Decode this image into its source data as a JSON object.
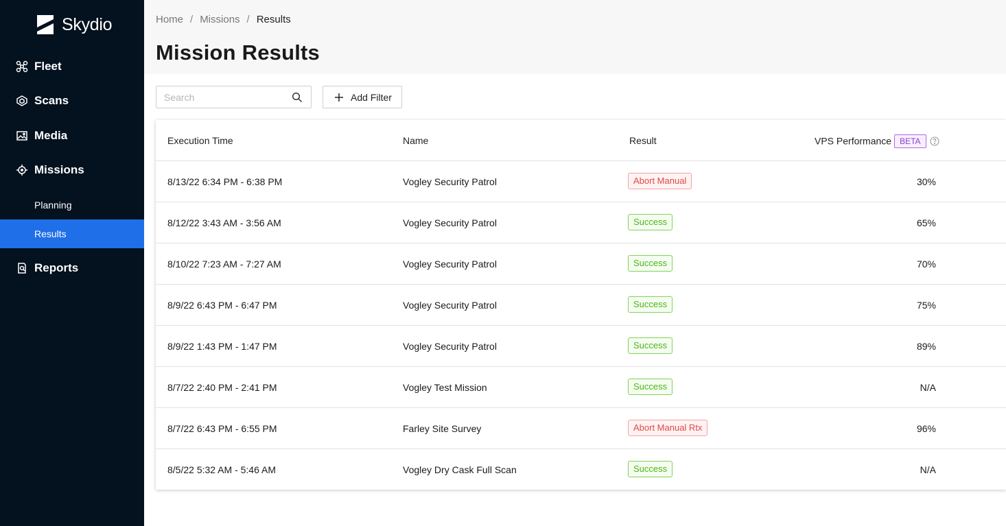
{
  "brand": {
    "name": "Skydio"
  },
  "sidebar": {
    "items": [
      {
        "label": "Fleet",
        "icon": "drone-icon"
      },
      {
        "label": "Scans",
        "icon": "scan-icon"
      },
      {
        "label": "Media",
        "icon": "image-icon"
      },
      {
        "label": "Missions",
        "icon": "target-icon"
      },
      {
        "label": "Reports",
        "icon": "report-icon"
      }
    ],
    "sub_items": [
      {
        "label": "Planning",
        "active": false
      },
      {
        "label": "Results",
        "active": true
      }
    ],
    "colors": {
      "background": "#04111f",
      "active": "#1f6fe8"
    }
  },
  "header": {
    "breadcrumb": [
      "Home",
      "Missions",
      "Results"
    ],
    "title": "Mission Results"
  },
  "toolbar": {
    "search_placeholder": "Search",
    "search_value": "",
    "add_filter_label": "Add Filter"
  },
  "table": {
    "columns": [
      "Execution Time",
      "Name",
      "Result",
      "VPS Performance"
    ],
    "beta_label": "BETA",
    "rows": [
      {
        "time": "8/13/22 6:34 PM - 6:38 PM",
        "name": "Vogley Security Patrol",
        "result": "Abort Manual",
        "status": "abort",
        "vps": "30%"
      },
      {
        "time": "8/12/22 3:43 AM - 3:56 AM",
        "name": "Vogley Security Patrol",
        "result": "Success",
        "status": "success",
        "vps": "65%"
      },
      {
        "time": "8/10/22 7:23 AM - 7:27 AM",
        "name": "Vogley Security Patrol",
        "result": "Success",
        "status": "success",
        "vps": "70%"
      },
      {
        "time": "8/9/22 6:43 PM - 6:47 PM",
        "name": "Vogley Security Patrol",
        "result": "Success",
        "status": "success",
        "vps": "75%"
      },
      {
        "time": "8/9/22 1:43 PM - 1:47 PM",
        "name": "Vogley Security Patrol",
        "result": "Success",
        "status": "success",
        "vps": "89%"
      },
      {
        "time": "8/7/22 2:40 PM - 2:41 PM",
        "name": "Vogley Test Mission",
        "result": "Success",
        "status": "success",
        "vps": "N/A"
      },
      {
        "time": "8/7/22 6:43 PM - 6:55 PM",
        "name": "Farley Site Survey",
        "result": "Abort Manual Rtx",
        "status": "abort",
        "vps": "96%"
      },
      {
        "time": "8/5/22 5:32 AM - 5:46 AM",
        "name": "Vogley Dry Cask Full Scan",
        "result": "Success",
        "status": "success",
        "vps": "N/A"
      }
    ],
    "status_colors": {
      "success": "#4bb51b",
      "abort": "#e04848"
    }
  }
}
